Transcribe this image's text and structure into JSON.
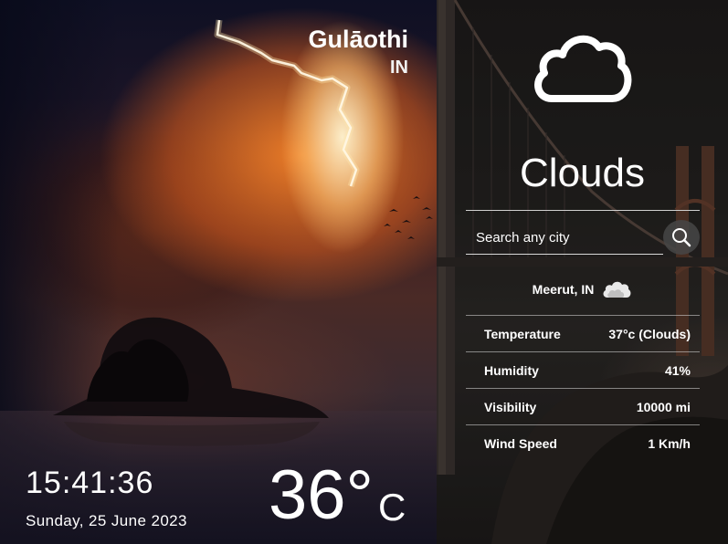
{
  "location": {
    "city": "Gulāothi",
    "country": "IN"
  },
  "clock": {
    "time": "15:41:36",
    "date": "Sunday, 25 June 2023"
  },
  "current": {
    "temperature": "36°",
    "unit": "C"
  },
  "weather": {
    "condition": "Clouds",
    "icon": "cloud-icon"
  },
  "search": {
    "placeholder": "Search any city",
    "value": "",
    "icon": "search-icon"
  },
  "result": {
    "location": "Meerut, IN",
    "icon": "small-cloud-icon"
  },
  "stats": [
    {
      "label": "Temperature",
      "value": "37°c (Clouds)"
    },
    {
      "label": "Humidity",
      "value": "41%"
    },
    {
      "label": "Visibility",
      "value": "10000 mi"
    },
    {
      "label": "Wind Speed",
      "value": "1 Km/h"
    }
  ],
  "colors": {
    "text": "#ffffff",
    "divider": "#cfcfcf",
    "search_button_bg": "#464646"
  }
}
